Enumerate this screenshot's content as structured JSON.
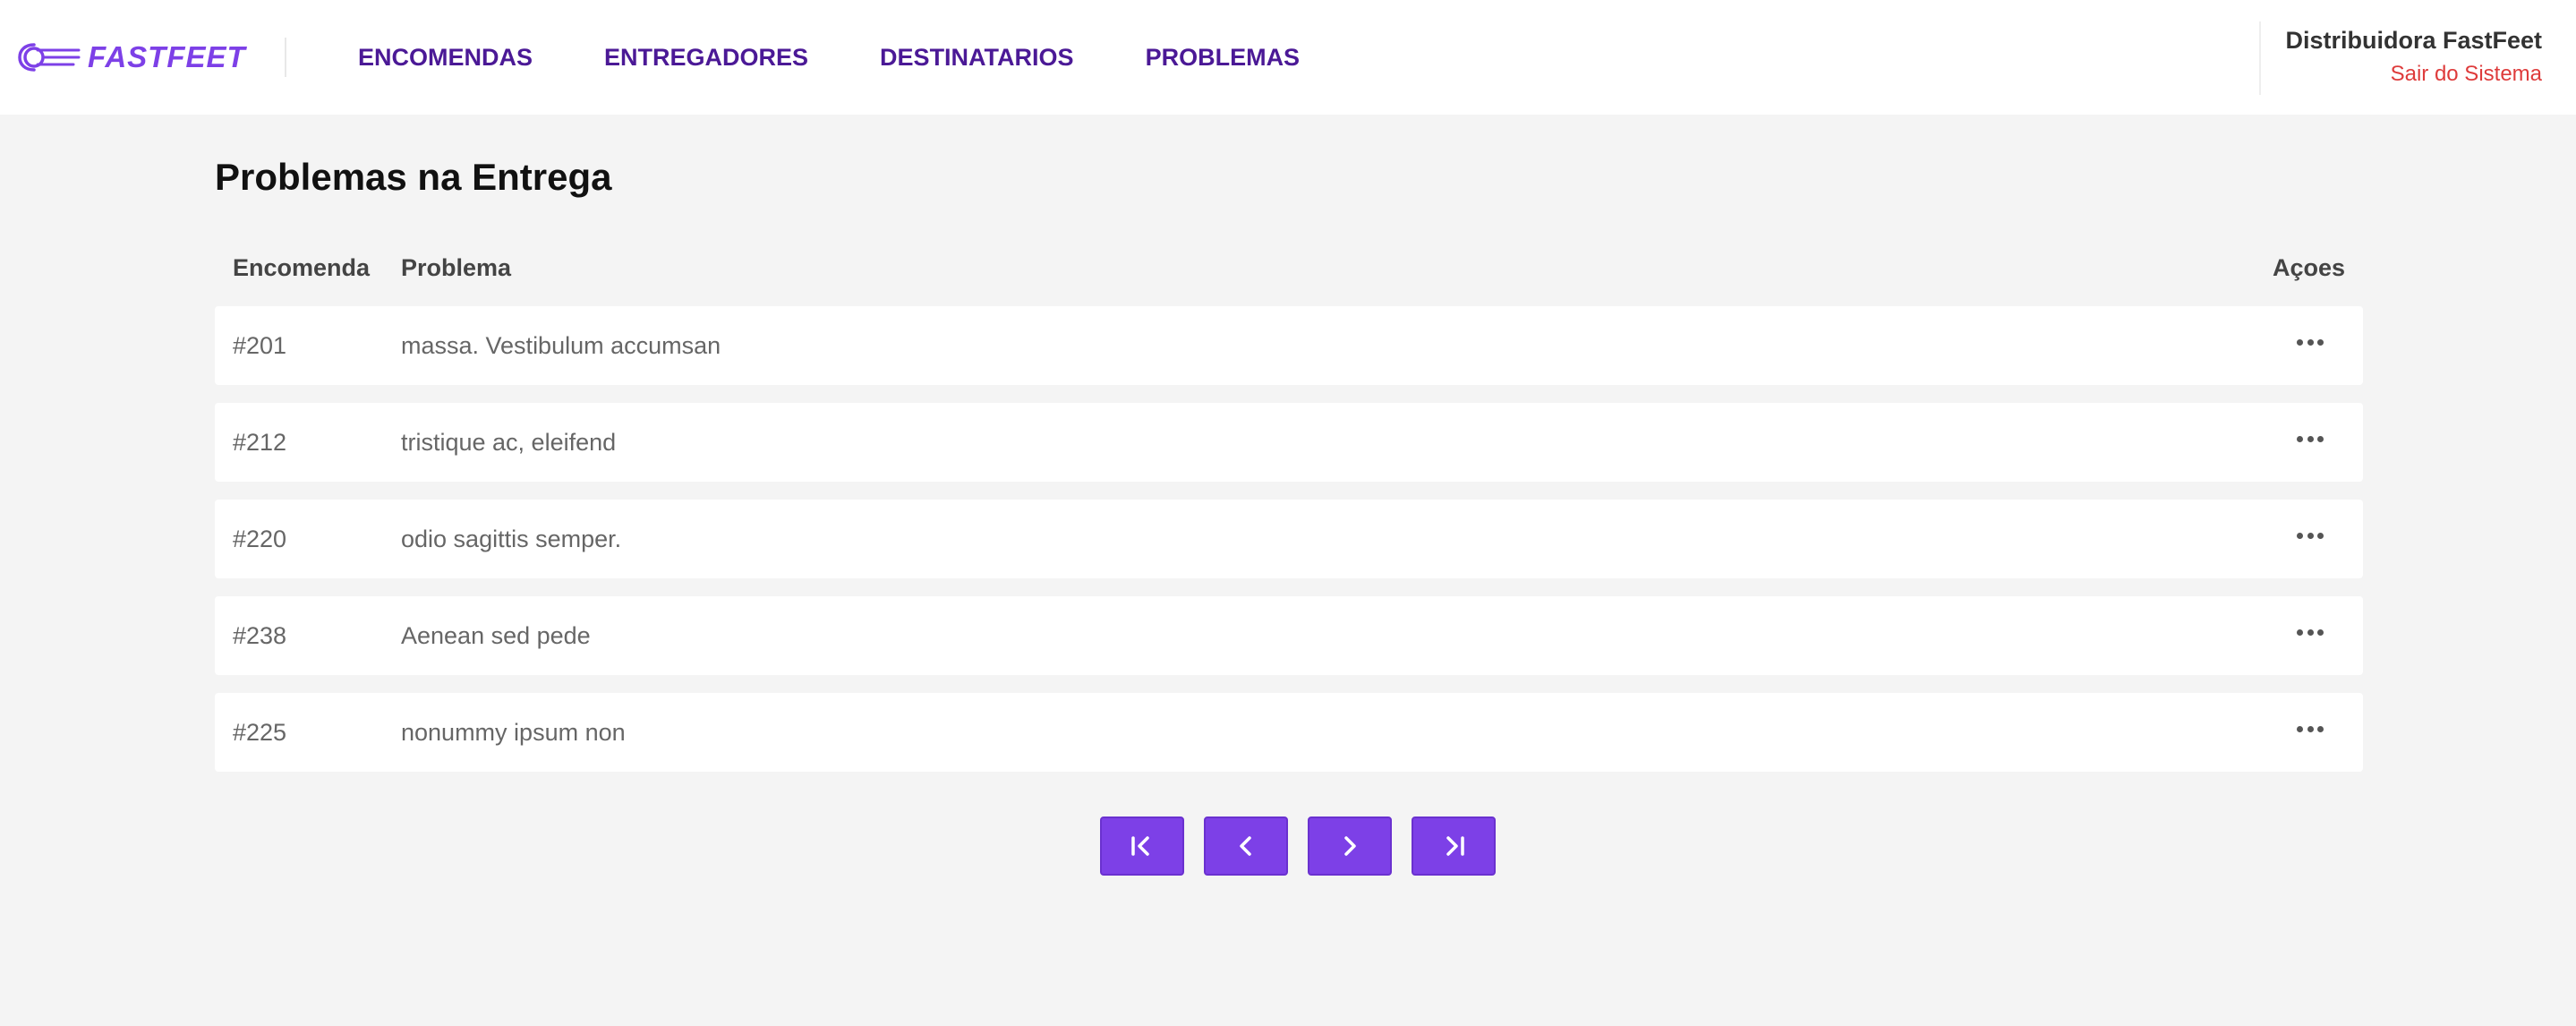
{
  "header": {
    "logo_text": "FASTFEET",
    "nav": [
      {
        "label": "ENCOMENDAS"
      },
      {
        "label": "ENTREGADORES"
      },
      {
        "label": "DESTINATARIOS"
      },
      {
        "label": "PROBLEMAS"
      }
    ],
    "profile": {
      "name": "Distribuidora FastFeet",
      "logout": "Sair do Sistema"
    }
  },
  "main": {
    "title": "Problemas na Entrega",
    "columns": {
      "encomenda": "Encomenda",
      "problema": "Problema",
      "acoes": "Açoes"
    },
    "rows": [
      {
        "id": "#201",
        "problem": "massa. Vestibulum accumsan"
      },
      {
        "id": "#212",
        "problem": "tristique ac, eleifend"
      },
      {
        "id": "#220",
        "problem": "odio sagittis semper."
      },
      {
        "id": "#238",
        "problem": "Aenean sed pede"
      },
      {
        "id": "#225",
        "problem": "nonummy ipsum non"
      }
    ]
  },
  "pagination": {
    "buttons": [
      "first-page-icon",
      "previous-page-icon",
      "next-page-icon",
      "last-page-icon"
    ]
  },
  "colors": {
    "accent": "#7d40e7",
    "nav": "#4b1996",
    "logout": "#de3b3b",
    "background": "#f4f4f4"
  }
}
